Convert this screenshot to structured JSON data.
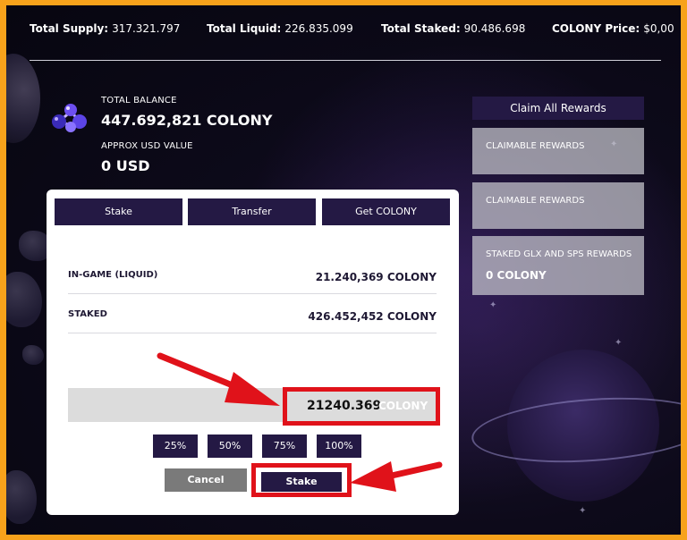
{
  "stats": {
    "total_supply_label": "Total Supply:",
    "total_supply_value": "317.321.797",
    "total_liquid_label": "Total Liquid:",
    "total_liquid_value": "226.835.099",
    "total_staked_label": "Total Staked:",
    "total_staked_value": "90.486.698",
    "price_label": "COLONY Price:",
    "price_value": "$0,00"
  },
  "balance": {
    "total_label": "TOTAL BALANCE",
    "total_value": "447.692,821 COLONY",
    "usd_label": "APPROX USD VALUE",
    "usd_value": "0 USD"
  },
  "rewards": {
    "claim_all_label": "Claim All Rewards",
    "cards": [
      {
        "title": "CLAIMABLE REWARDS",
        "amount": ""
      },
      {
        "title": "CLAIMABLE REWARDS",
        "amount": ""
      },
      {
        "title": "STAKED GLX AND SPS REWARDS",
        "amount": "0 COLONY"
      }
    ]
  },
  "modal": {
    "tabs": [
      "Stake",
      "Transfer",
      "Get COLONY"
    ],
    "rows": [
      {
        "label": "IN-GAME (LIQUID)",
        "value": "21.240,369 COLONY"
      },
      {
        "label": "STAKED",
        "value": "426.452,452 COLONY"
      }
    ],
    "amount_value": "21240.369",
    "amount_unit": "COLONY",
    "percent_buttons": [
      "25%",
      "50%",
      "75%",
      "100%"
    ],
    "cancel_label": "Cancel",
    "stake_label": "Stake"
  },
  "colors": {
    "frame": "#f7a21b",
    "button": "#241944",
    "highlight": "#e0121a",
    "cancel": "#7a7a7a"
  }
}
